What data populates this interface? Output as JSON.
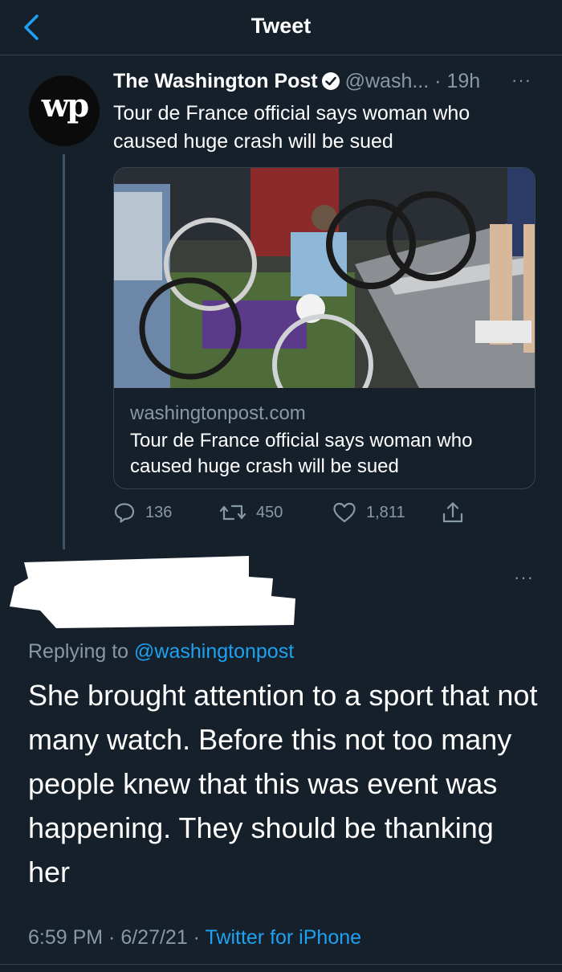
{
  "header": {
    "title": "Tweet"
  },
  "quoted_tweet": {
    "avatar_text": "wp",
    "name": "The Washington Post",
    "handle": "@wash...",
    "separator": "·",
    "time": "19h",
    "more": "···",
    "text": "Tour de France official says woman who caused huge crash will be sued",
    "link_card": {
      "domain": "washingtonpost.com",
      "title": "Tour de France official says woman who caused huge crash will be sued"
    },
    "actions": {
      "replies": "136",
      "retweets": "450",
      "likes": "1,811"
    }
  },
  "reply": {
    "more": "···",
    "replying_prefix": "Replying to",
    "replying_mention": "@washingtonpost",
    "text": "She brought attention to a sport that not many watch. Before this not too many people knew that this was event was happening. They should be thanking her",
    "time": "6:59 PM · 6/27/21 · ",
    "source": "Twitter for iPhone"
  },
  "colors": {
    "background": "#15202b",
    "accent": "#1da1f2",
    "muted": "#8899a6",
    "border": "#38444d"
  }
}
